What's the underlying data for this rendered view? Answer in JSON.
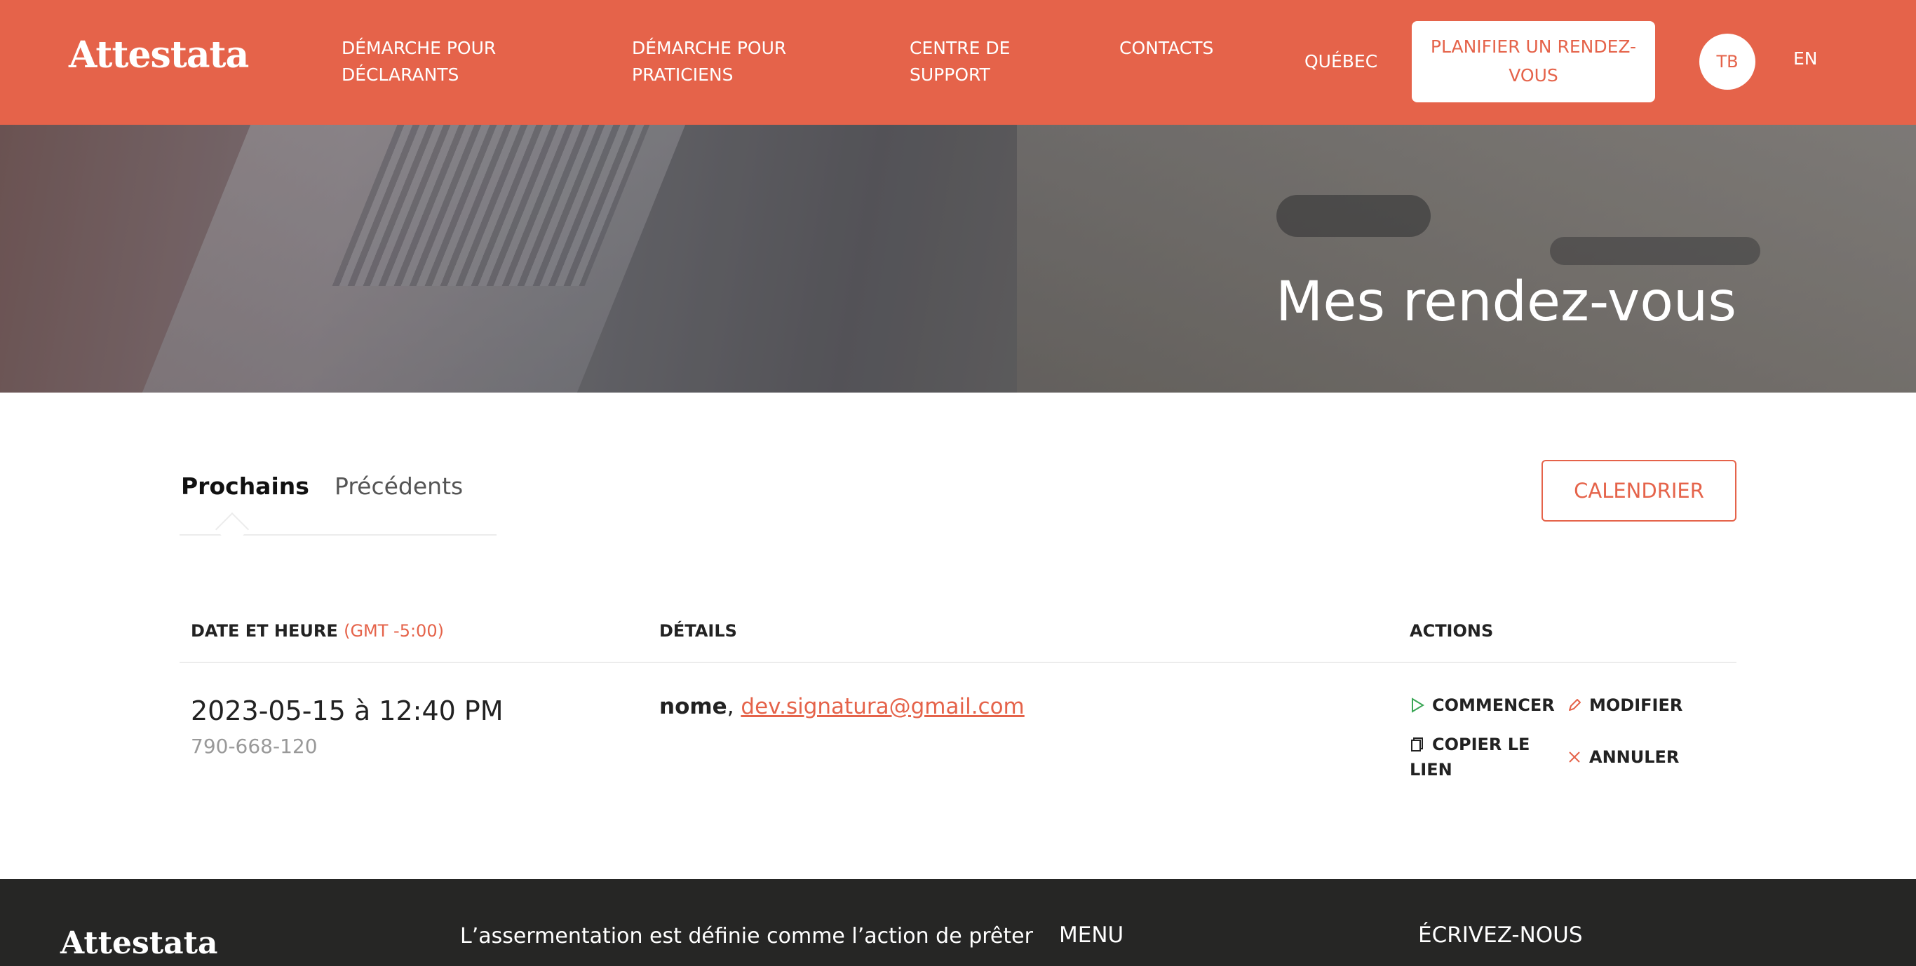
{
  "header": {
    "logo": "Attestata",
    "nav": [
      {
        "label": "DÉMARCHE POUR DÉCLARANTS"
      },
      {
        "label": "DÉMARCHE POUR PRATICIENS"
      },
      {
        "label": "CENTRE DE SUPPORT"
      },
      {
        "label": "CONTACTS"
      },
      {
        "label": "QUÉBEC"
      }
    ],
    "cta_label": "PLANIFIER UN RENDEZ-VOUS",
    "avatar_initials": "TB",
    "lang": "EN"
  },
  "hero": {
    "title": "Mes rendez-vous"
  },
  "tabs": {
    "active": "Prochains",
    "inactive": "Précédents"
  },
  "calendar_button": "CALENDRIER",
  "table": {
    "columns": {
      "date": "DATE ET HEURE",
      "timezone": "(GMT -5:00)",
      "details": "DÉTAILS",
      "actions": "ACTIONS"
    },
    "rows": [
      {
        "datetime": "2023-05-15 à 12:40 PM",
        "id": "790-668-120",
        "name": "nome",
        "separator": ", ",
        "email": "dev.signatura@gmail.com",
        "actions": {
          "start": "COMMENCER",
          "edit": "MODIFIER",
          "copy": "COPIER LE LIEN",
          "cancel": "ANNULER"
        }
      }
    ]
  },
  "footer": {
    "logo": "Attestata",
    "text": "L’assermentation est définie comme l’action de prêter",
    "menu_heading": "MENU",
    "write_heading": "ÉCRIVEZ-NOUS"
  },
  "colors": {
    "brand": "#e5634a",
    "footer_bg": "#262625",
    "start_icon": "#3aa655"
  },
  "icons": {
    "start": "play-outline-icon",
    "edit": "pencil-icon",
    "copy": "copy-icon",
    "cancel": "close-icon"
  }
}
